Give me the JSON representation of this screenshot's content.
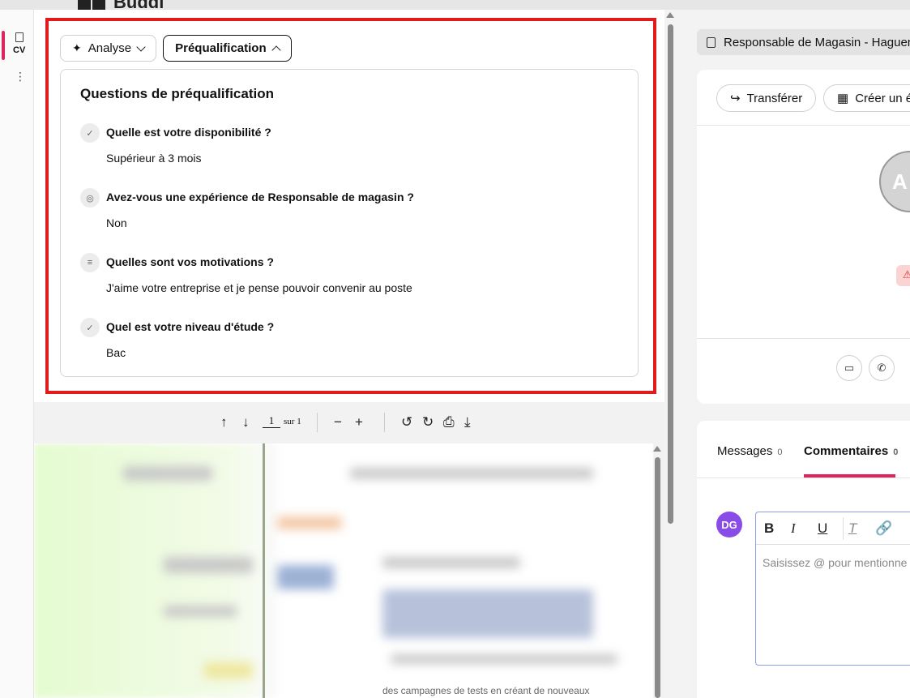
{
  "app": {
    "brand_name": "Buddi"
  },
  "rail": {
    "cv_label": "CV",
    "more_glyph": "⋮"
  },
  "tabs": {
    "analyse_label": "Analyse",
    "prequalification_label": "Préqualification"
  },
  "prequal": {
    "title": "Questions de préqualification",
    "questions": [
      {
        "icon": "check-icon",
        "glyph": "✓",
        "question": "Quelle est votre disponibilité ?",
        "answer": "Supérieur à 3 mois"
      },
      {
        "icon": "radio-check-icon",
        "glyph": "◎",
        "question": "Avez-vous une expérience de Responsable de magasin ?",
        "answer": "Non"
      },
      {
        "icon": "text-lines-icon",
        "glyph": "≡",
        "question": "Quelles sont vos motivations ?",
        "answer": "J'aime votre entreprise et je pense pouvoir convenir au poste"
      },
      {
        "icon": "check-icon",
        "glyph": "✓",
        "question": "Quel est votre niveau d'étude ?",
        "answer": "Bac"
      }
    ]
  },
  "pdf_toolbar": {
    "page_current": "1",
    "page_of": "sur 1",
    "icons": [
      "arrow-up-icon",
      "arrow-down-icon",
      "zoom-out-icon",
      "zoom-in-icon",
      "rotate-left-icon",
      "rotate-right-icon",
      "print-icon",
      "download-icon"
    ]
  },
  "preview": {
    "visible_line": "des campagnes de tests en créant de nouveaux"
  },
  "right": {
    "job_title": "Responsable de Magasin - Haguer",
    "transfer_label": "Transférer",
    "create_label": "Créer un é",
    "avatar_initials": "A",
    "warning_glyph": "⚠"
  },
  "comments": {
    "tabs": [
      {
        "label": "Messages",
        "count": "0"
      },
      {
        "label": "Commentaires",
        "count": "0"
      }
    ],
    "avatar_initials": "DG",
    "placeholder": "Saisissez @ pour mentionne",
    "avatar_color": "#8a4ce8"
  },
  "colors": {
    "accent": "#e0245e",
    "highlight_border": "#e01b1b"
  }
}
